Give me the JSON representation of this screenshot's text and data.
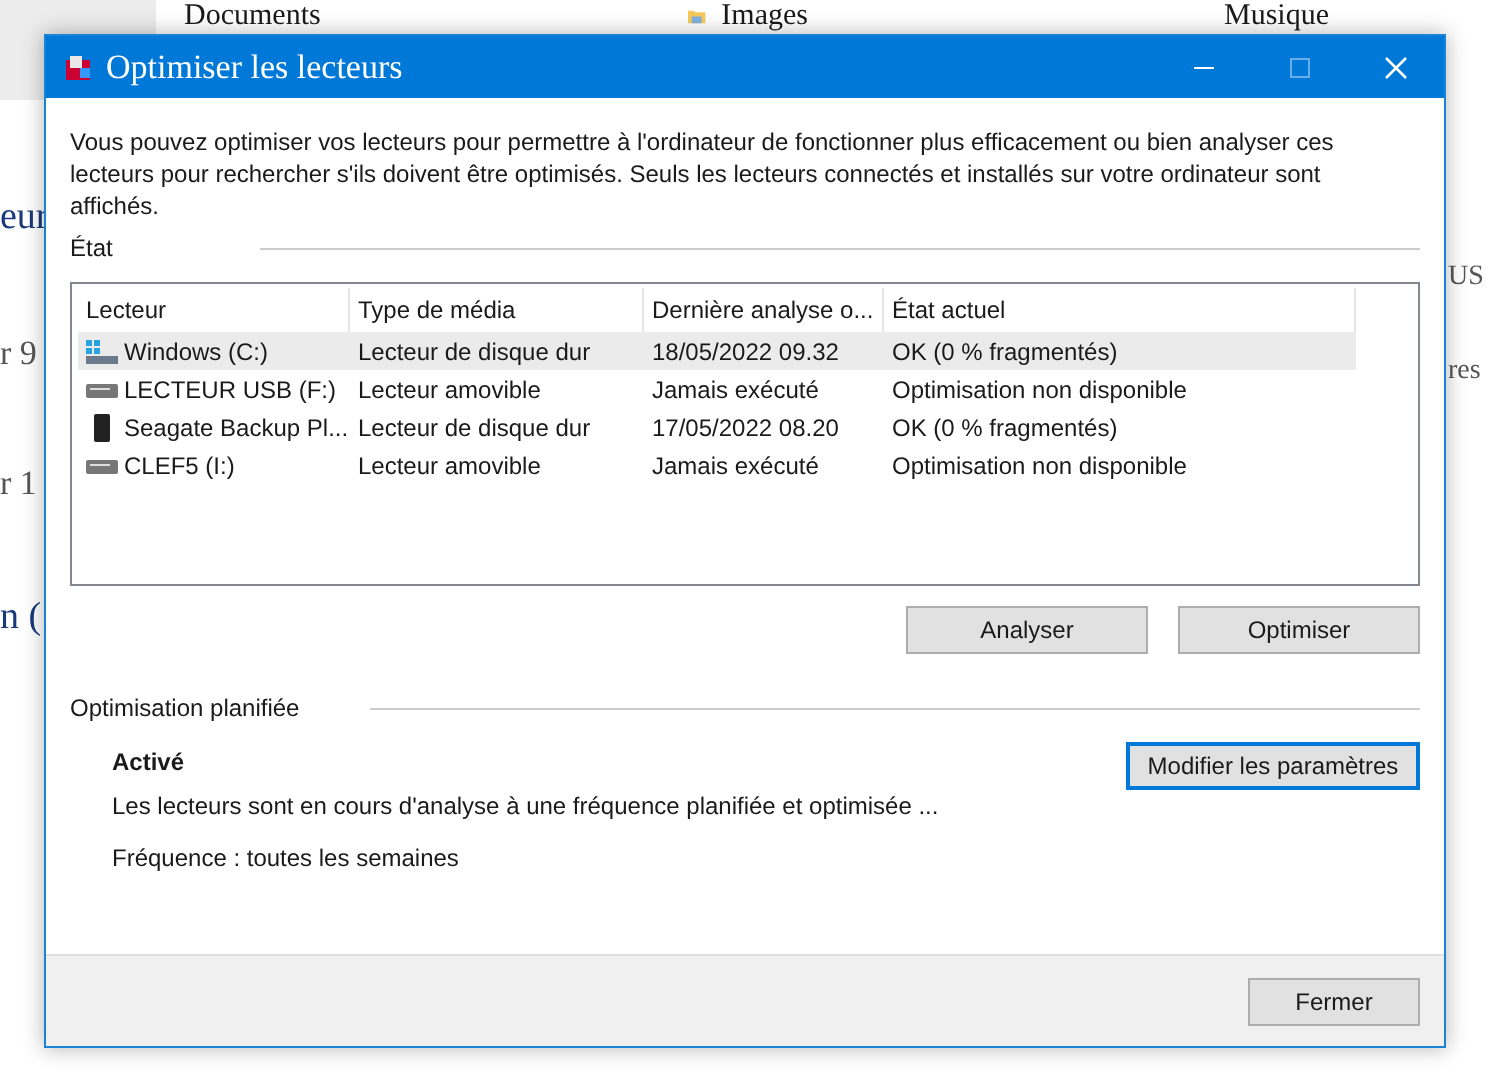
{
  "background": {
    "folders": [
      {
        "label": "Documents",
        "kind": "documents"
      },
      {
        "label": "Images",
        "kind": "images"
      },
      {
        "label": "Musique",
        "kind": "music"
      }
    ],
    "left_fragments": [
      "eur",
      "r 9",
      "r 1",
      "n ("
    ],
    "right_fragments": [
      "US",
      "res"
    ]
  },
  "window": {
    "title": "Optimiser les lecteurs"
  },
  "intro": "Vous pouvez optimiser vos lecteurs pour permettre à l'ordinateur de fonctionner plus efficacement ou bien analyser ces lecteurs pour rechercher s'ils doivent être optimisés. Seuls les lecteurs connectés et installés sur votre ordinateur sont affichés.",
  "status_group": "État",
  "table": {
    "columns": [
      "Lecteur",
      "Type de média",
      "Dernière analyse o...",
      "État actuel"
    ],
    "rows": [
      {
        "kind": "system",
        "selected": true,
        "cells": [
          "Windows (C:)",
          "Lecteur de disque dur",
          "18/05/2022 09.32",
          "OK (0 % fragmentés)"
        ]
      },
      {
        "kind": "removable",
        "selected": false,
        "cells": [
          "LECTEUR USB (F:)",
          "Lecteur amovible",
          "Jamais exécuté",
          "Optimisation non disponible"
        ]
      },
      {
        "kind": "external",
        "selected": false,
        "cells": [
          "Seagate Backup Pl...",
          "Lecteur de disque dur",
          "17/05/2022 08.20",
          "OK (0 % fragmentés)"
        ]
      },
      {
        "kind": "removable",
        "selected": false,
        "cells": [
          "CLEF5 (I:)",
          "Lecteur amovible",
          "Jamais exécuté",
          "Optimisation non disponible"
        ]
      }
    ]
  },
  "actions": [
    "Analyser",
    "Optimiser"
  ],
  "schedule": {
    "title": "Optimisation planifiée",
    "state": "Activé",
    "description": "Les lecteurs sont en cours d'analyse à une fréquence planifiée et optimisée ...",
    "frequency": "Fréquence : toutes les semaines",
    "button": "Modifier les paramètres"
  },
  "footer": {
    "button": "Fermer"
  }
}
